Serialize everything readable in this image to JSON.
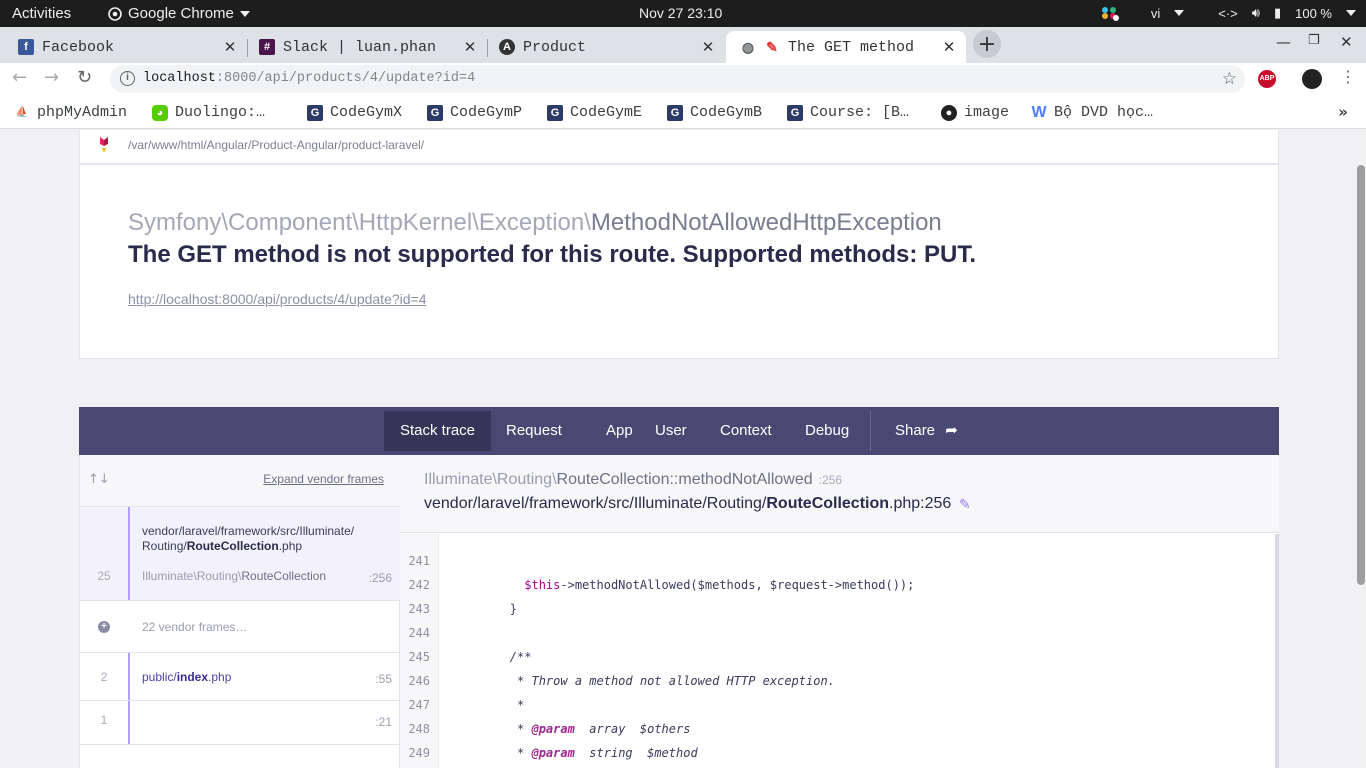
{
  "os": {
    "activities": "Activities",
    "app_name": "Google Chrome",
    "clock": "Nov 27  23:10",
    "lang": "vi",
    "battery": "100 %"
  },
  "tabs": [
    {
      "title": "Facebook",
      "icon": "facebook-icon",
      "color": "#3b5998"
    },
    {
      "title": "Slack | luan.phan",
      "icon": "slack-icon",
      "color": "#4a154b"
    },
    {
      "title": "Product",
      "icon": "angular-icon",
      "color": "#333333"
    },
    {
      "title": "The GET method",
      "icon": "ignition-icon",
      "color": "#e53935"
    }
  ],
  "toolbar": {
    "url_host": "localhost",
    "url_rest": ":8000/api/products/4/update?id=4"
  },
  "bookmarks": [
    {
      "label": "phpMyAdmin",
      "icon": "phpmyadmin-icon"
    },
    {
      "label": "Duolingo:…",
      "icon": "duolingo-icon"
    },
    {
      "label": "CodeGymX",
      "icon": "codegym-icon"
    },
    {
      "label": "CodeGymP",
      "icon": "codegym-icon"
    },
    {
      "label": "CodeGymE",
      "icon": "codegym-icon"
    },
    {
      "label": "CodeGymB",
      "icon": "codegym-icon"
    },
    {
      "label": "Course: [B…",
      "icon": "codegym-icon"
    },
    {
      "label": "image",
      "icon": "github-icon"
    },
    {
      "label": "Bộ DVD học…",
      "icon": "w-icon"
    }
  ],
  "page": {
    "project_path": "/var/www/html/Angular/Product-Angular/product-laravel/",
    "exception_ns": "Symfony\\Component\\HttpKernel\\Exception\\",
    "exception_name": "MethodNotAllowedHttpException",
    "message": "The GET method is not supported for this route. Supported methods: PUT.",
    "url": "http://localhost:8000/api/products/4/update?id=4"
  },
  "nav": [
    "Stack trace",
    "Request",
    "App",
    "User",
    "Context",
    "Debug",
    "Share"
  ],
  "stack": {
    "expand_label": "Expand vendor frames",
    "frames": [
      {
        "num": "25",
        "file_prefix": "vendor/laravel/framework/src/Illuminate/",
        "file_prefix2": "Routing/",
        "file_name": "RouteCollection",
        "file_ext": ".php",
        "cls_ns": "Illuminate\\Routing\\",
        "cls_name": "RouteCollection",
        "line": ":256"
      },
      {
        "vendor_label": "22 vendor frames…"
      },
      {
        "num": "2",
        "file_prefix": "public/",
        "file_name": "index",
        "file_ext": ".php",
        "line": ":55"
      },
      {
        "num": "1",
        "line": ":21"
      }
    ]
  },
  "detail": {
    "method_ns": "Illuminate\\Routing\\",
    "method_cls": "RouteCollection",
    "method_name": "::methodNotAllowed",
    "method_line": ":256",
    "file_prefix": "vendor/laravel/framework/src/Illuminate/Routing/",
    "file_name": "RouteCollection",
    "file_ext": ".php:256"
  },
  "code": [
    {
      "no": "241",
      "text": ""
    },
    {
      "no": "242",
      "text": "            $this->methodNotAllowed($methods, $request->method());"
    },
    {
      "no": "243",
      "text": "        }"
    },
    {
      "no": "244",
      "text": ""
    },
    {
      "no": "245",
      "text": "        /**"
    },
    {
      "no": "246",
      "text": "         * Throw a method not allowed HTTP exception."
    },
    {
      "no": "247",
      "text": "         *"
    },
    {
      "no": "248",
      "text": "         * @param  array  $others"
    },
    {
      "no": "249",
      "text": "         * @param  string  $method"
    }
  ]
}
